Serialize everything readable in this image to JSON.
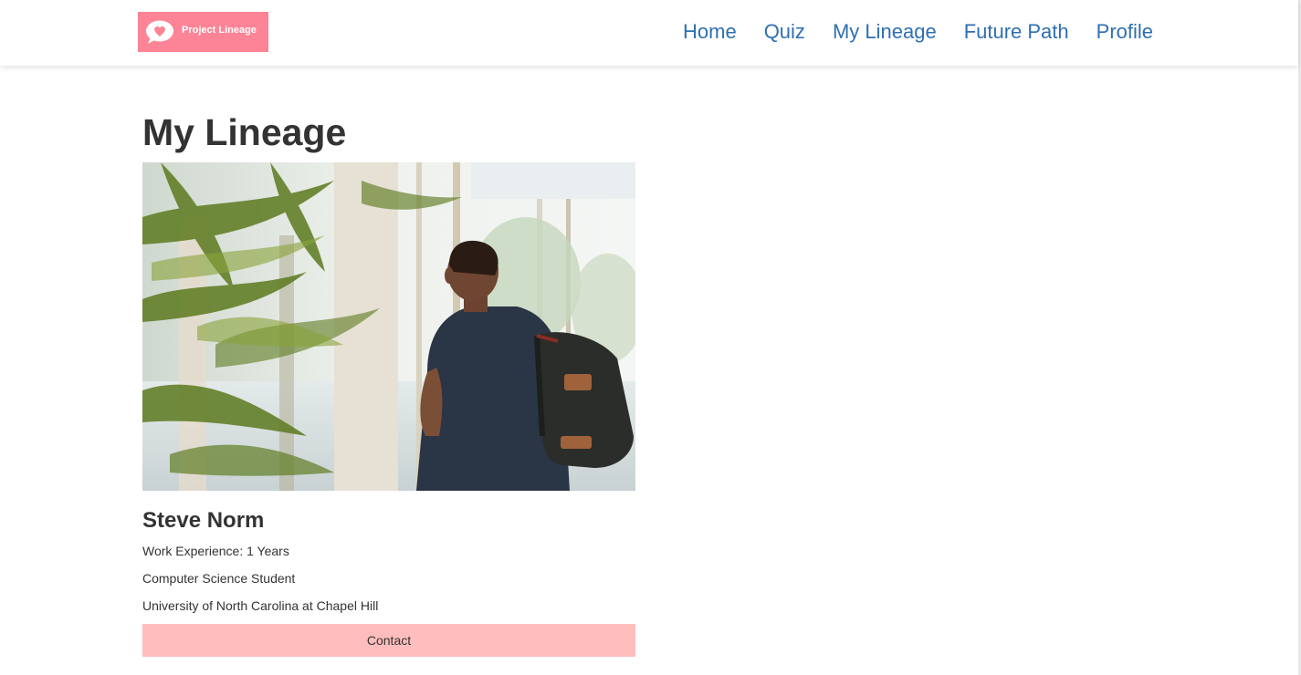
{
  "brand": {
    "name": "Project Lineage",
    "color": "#fc8496",
    "icon": "chat-heart-icon"
  },
  "nav": {
    "link_color": "#2f6fb2",
    "items": [
      {
        "label": "Home"
      },
      {
        "label": "Quiz"
      },
      {
        "label": "My Lineage"
      },
      {
        "label": "Future Path"
      },
      {
        "label": "Profile"
      }
    ]
  },
  "page": {
    "title": "My Lineage"
  },
  "mentor_card": {
    "photo": "student-with-backpack-photo",
    "name": "Steve Norm",
    "work_experience": "Work Experience: 1 Years",
    "role": "Computer Science Student",
    "school": "University of North Carolina at Chapel Hill",
    "contact_label": "Contact",
    "contact_color": "#ffbdbd"
  }
}
